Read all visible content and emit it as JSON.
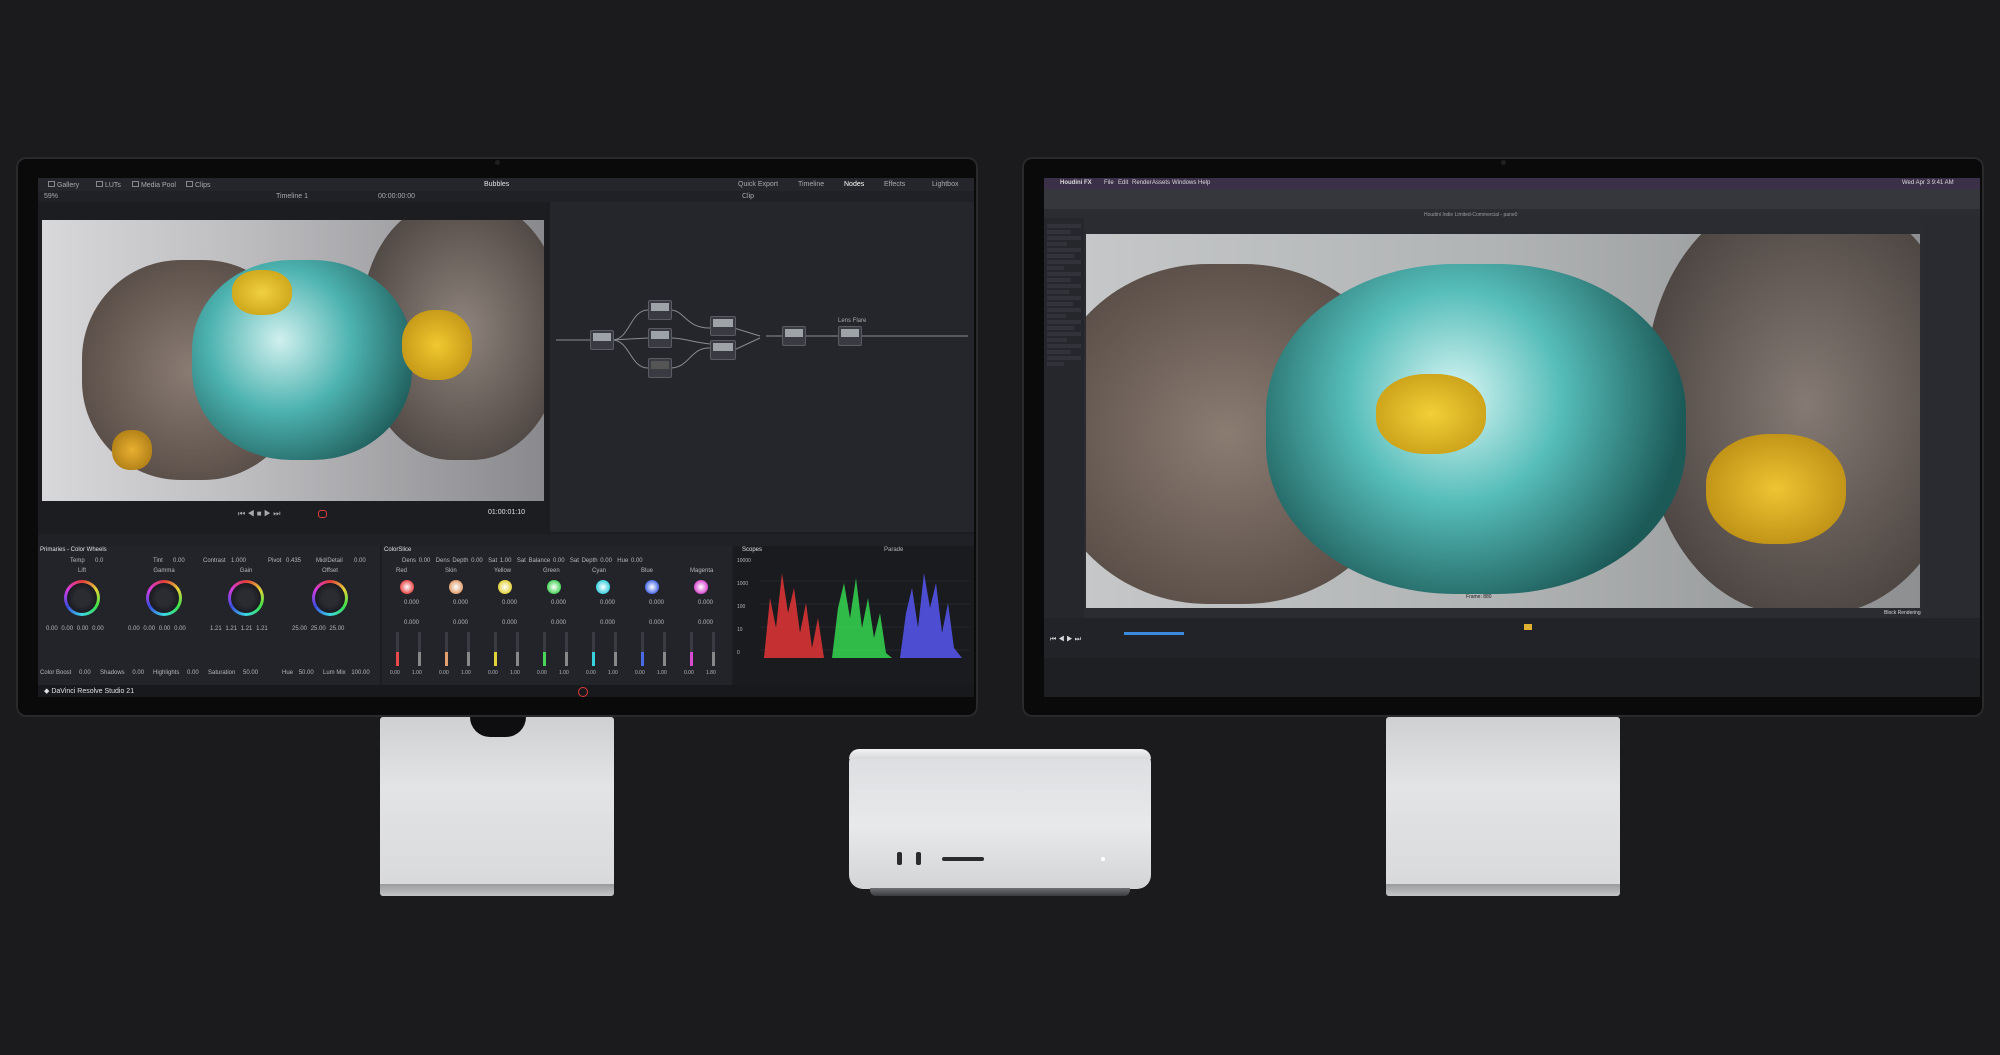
{
  "resolve": {
    "title": "Bubbles",
    "tabs_left": [
      "Gallery",
      "LUTs",
      "Media Pool",
      "Clips"
    ],
    "tabs_right": [
      "Quick Export",
      "Timeline",
      "Nodes",
      "Effects",
      "Lightbox"
    ],
    "zoom": "59%",
    "timeline_name": "Timeline 1",
    "timecode_top": "00:00:00:00",
    "clip_label": "Clip",
    "timecode": "01:00:01:10",
    "node_label": "Lens Flare",
    "primaries_label": "Primaries - Color Wheels",
    "colorslice_label": "ColorSlice",
    "scopes_label": "Scopes",
    "parade_label": "Parade",
    "temp_label": "Temp",
    "temp_val": "0.0",
    "tint_label": "Tint",
    "tint_val": "0.00",
    "contrast_label": "Contrast",
    "contrast_val": "1.000",
    "pivot_label": "Pivot",
    "pivot_val": "0.435",
    "middetail_label": "Mid/Detail",
    "middetail_val": "0.00",
    "wheels": [
      {
        "name": "Lift",
        "vals": [
          "0.00",
          "0.00",
          "0.00",
          "0.00"
        ]
      },
      {
        "name": "Gamma",
        "vals": [
          "0.00",
          "0.00",
          "0.00",
          "0.00"
        ]
      },
      {
        "name": "Gain",
        "vals": [
          "1.21",
          "1.21",
          "1.21",
          "1.21"
        ]
      },
      {
        "name": "Offset",
        "vals": [
          "25.00",
          "25.00",
          "25.00",
          ""
        ]
      }
    ],
    "bottom_controls": [
      {
        "label": "Color Boost",
        "val": "0.00"
      },
      {
        "label": "Shadows",
        "val": "0.00"
      },
      {
        "label": "Highlights",
        "val": "0.00"
      },
      {
        "label": "Saturation",
        "val": "50.00"
      },
      {
        "label": "Hue",
        "val": "50.00"
      },
      {
        "label": "Lum Mix",
        "val": "100.00"
      }
    ],
    "slice_top": [
      {
        "label": "Dens",
        "val": "0.00"
      },
      {
        "label": "Dens Depth",
        "val": "0.00"
      },
      {
        "label": "Sat",
        "val": "1.00"
      },
      {
        "label": "Sat Balance",
        "val": "0.00"
      },
      {
        "label": "Sat Depth",
        "val": "0.00"
      },
      {
        "label": "Hue",
        "val": "0.00"
      }
    ],
    "slices": [
      {
        "name": "Red",
        "color": "#e84a4a",
        "center": "0.000",
        "fine": "0.000"
      },
      {
        "name": "Skin",
        "color": "#e0a070",
        "center": "0.000",
        "fine": "0.000"
      },
      {
        "name": "Yellow",
        "color": "#e2d23b",
        "center": "0.000",
        "fine": "0.000"
      },
      {
        "name": "Green",
        "color": "#4ad45a",
        "center": "0.000",
        "fine": "0.000"
      },
      {
        "name": "Cyan",
        "color": "#3bd0e0",
        "center": "0.000",
        "fine": "0.000"
      },
      {
        "name": "Blue",
        "color": "#4a6ae8",
        "center": "0.000",
        "fine": "0.000"
      },
      {
        "name": "Magenta",
        "color": "#d84ad0",
        "center": "0.000",
        "fine": "0.000"
      }
    ],
    "slice_bottom_vals": [
      "0.00",
      "1.00",
      "0.00",
      "1.00",
      "0.00",
      "1.00",
      "0.00",
      "1.00",
      "0.00",
      "1.00",
      "0.00",
      "1.00",
      "0.00",
      "1.80"
    ],
    "scope_ticks": [
      "10000",
      "1000",
      "100",
      "10",
      "0"
    ],
    "brand": "DaVinci Resolve Studio 21"
  },
  "houdini": {
    "app": "Houdini FX",
    "menu": [
      "File",
      "Edit",
      "Render",
      "Assets",
      "Windows",
      "Help"
    ],
    "title": "Houdini Indie Limited-Commercial - pane0",
    "clock": "Wed Apr 3 9:41 AM",
    "frame_text": "Frame: 880",
    "status_right": "Block Rendering"
  },
  "colors": {
    "background": "#1b1b1d",
    "resolve_bg": "#1c1d21",
    "accent_red": "#e03b3b",
    "scope_red": "#ff3a3a",
    "scope_green": "#3aff5a",
    "scope_blue": "#5a5aff"
  }
}
